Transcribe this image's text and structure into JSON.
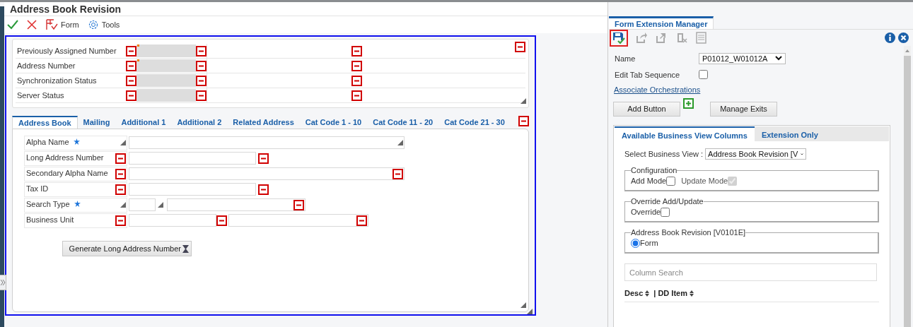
{
  "window": {
    "title": "Address Book Revision"
  },
  "toolbar": [
    {
      "kind": "ok"
    },
    {
      "kind": "cancel"
    },
    {
      "kind": "form",
      "label": "Form"
    },
    {
      "kind": "tools",
      "label": "Tools"
    }
  ],
  "header_fields": [
    {
      "label": "Previously Assigned Number",
      "flagged": true
    },
    {
      "label": "Address Number",
      "flagged": true
    },
    {
      "label": "Synchronization Status",
      "flagged": false
    },
    {
      "label": "Server Status",
      "flagged": false
    }
  ],
  "tabs": [
    {
      "label": "Address Book",
      "selected": true
    },
    {
      "label": "Mailing",
      "selected": false
    },
    {
      "label": "Additional 1",
      "selected": false
    },
    {
      "label": "Additional 2",
      "selected": false
    },
    {
      "label": "Related Address",
      "selected": false
    },
    {
      "label": "Cat Code 1 - 10",
      "selected": false
    },
    {
      "label": "Cat Code 11 - 20",
      "selected": false
    },
    {
      "label": "Cat Code 21 - 30",
      "selected": false
    }
  ],
  "fields": [
    {
      "label": "Alpha Name",
      "required": true,
      "kind": "wide"
    },
    {
      "label": "Long Address Number",
      "required": false,
      "kind": "medium"
    },
    {
      "label": "Secondary Alpha Name",
      "required": false,
      "kind": "wide"
    },
    {
      "label": "Tax ID",
      "required": false,
      "kind": "medium"
    },
    {
      "label": "Search Type",
      "required": true,
      "kind": "code"
    },
    {
      "label": "Business Unit",
      "required": false,
      "kind": "pair"
    }
  ],
  "generate_button": {
    "label": "Generate Long Address Number"
  },
  "extension_manager": {
    "tab": "Form Extension Manager",
    "name_label": "Name",
    "name_value": "P01012_W01012A",
    "edit_tab_label": "Edit Tab Sequence",
    "edit_tab_checked": false,
    "link": "Associate Orchestrations",
    "buttons": [
      "Add Button",
      "Manage Exits"
    ],
    "subtabs": [
      {
        "label": "Available Business View Columns",
        "selected": true
      },
      {
        "label": "Extension Only",
        "selected": false
      }
    ],
    "business_view_label": "Select Business View :",
    "business_view_value": "Address Book Revision [V",
    "groups": [
      {
        "legend": "Configuration",
        "options": [
          {
            "kind": "checkbox",
            "label": "Add Mode",
            "checked": false,
            "disabled": false
          },
          {
            "kind": "checkbox",
            "label": "Update Mode",
            "checked": true,
            "disabled": true
          }
        ]
      },
      {
        "legend": "Override Add/Update",
        "options": [
          {
            "kind": "checkbox",
            "label": "Override",
            "checked": false,
            "disabled": false
          }
        ]
      },
      {
        "legend": "Address Book Revision [V0101E]",
        "options": [
          {
            "kind": "radio",
            "label": "Form",
            "checked": true,
            "disabled": false
          }
        ]
      }
    ],
    "column_search": {
      "placeholder": "Column Search"
    },
    "columns": [
      "Desc",
      "| DD Item"
    ]
  }
}
